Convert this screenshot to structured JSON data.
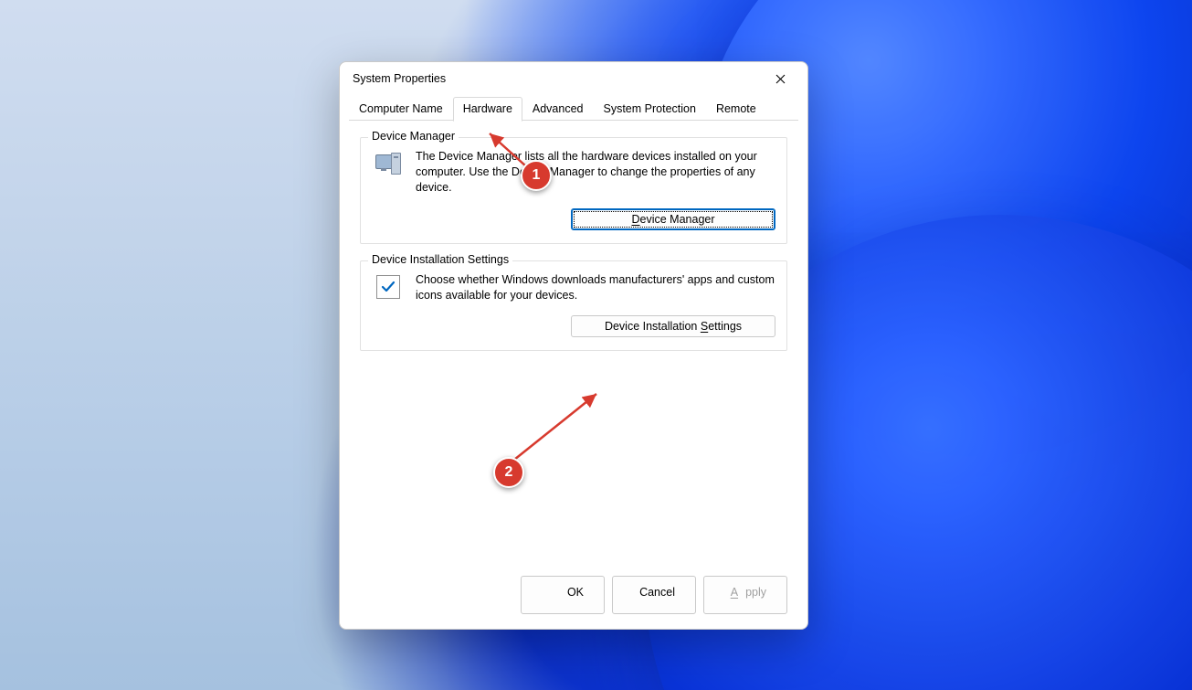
{
  "window": {
    "title": "System Properties"
  },
  "tabs": {
    "computer_name": "Computer Name",
    "hardware": "Hardware",
    "advanced": "Advanced",
    "system_protection": "System Protection",
    "remote": "Remote",
    "active": "hardware"
  },
  "groups": {
    "device_manager": {
      "title": "Device Manager",
      "description": "The Device Manager lists all the hardware devices installed on your computer. Use the Device Manager to change the properties of any device.",
      "button_pre": "",
      "button_u": "D",
      "button_post": "evice Manager"
    },
    "install_settings": {
      "title": "Device Installation Settings",
      "description": "Choose whether Windows downloads manufacturers' apps and custom icons available for your devices.",
      "button_pre": "Device Installation ",
      "button_u": "S",
      "button_post": "ettings"
    }
  },
  "footer": {
    "ok": "OK",
    "cancel": "Cancel",
    "apply_u": "A",
    "apply_post": "pply"
  },
  "annotations": {
    "step1": "1",
    "step2": "2"
  }
}
